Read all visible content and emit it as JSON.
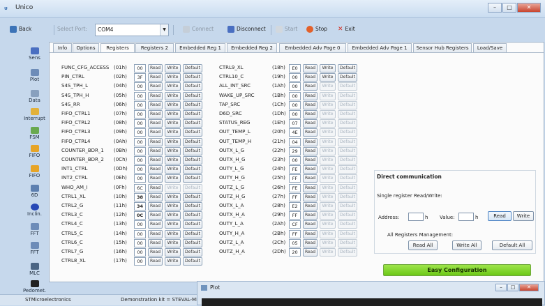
{
  "window": {
    "title": "Unico",
    "app_icon": "unico-logo-icon"
  },
  "toolbar": {
    "back": "Back",
    "select_port": "Select Port:",
    "port": "COM4",
    "connect": "Connect",
    "disconnect": "Disconnect",
    "start": "Start",
    "stop": "Stop",
    "exit": "Exit"
  },
  "sidebar": [
    {
      "label": "Sens",
      "icon": "bars-icon"
    },
    {
      "label": "Plot",
      "icon": "plot-icon"
    },
    {
      "label": "Data",
      "icon": "data-icon"
    },
    {
      "label": "Interrupt",
      "icon": "interrupt-icon"
    },
    {
      "label": "FSM",
      "icon": "fsm-icon"
    },
    {
      "label": "FIFO",
      "icon": "fifo-icon"
    },
    {
      "label": "FIFO",
      "icon": "fifo2-icon"
    },
    {
      "label": "6D",
      "icon": "6d-icon"
    },
    {
      "label": "Inclin.",
      "icon": "inclin-icon"
    },
    {
      "label": "FFT",
      "icon": "fft-icon"
    },
    {
      "label": "FFT",
      "icon": "fft2-icon"
    },
    {
      "label": "MLC",
      "icon": "mlc-icon"
    },
    {
      "label": "Pedomet.",
      "icon": "pedometer-icon"
    }
  ],
  "tabs": [
    "Info",
    "Options",
    "Registers",
    "Registers 2",
    "Embedded Reg 1",
    "Embedded Reg 2",
    "Embedded Adv Page 0",
    "Embedded Adv Page 1",
    "Sensor Hub Registers",
    "Load/Save"
  ],
  "buttons": {
    "read": "Read",
    "write": "Write",
    "default": "Default"
  },
  "registers_left": [
    {
      "name": "FUNC_CFG_ACCESS",
      "addr": "(01h)",
      "value": "00"
    },
    {
      "name": "PIN_CTRL",
      "addr": "(02h)",
      "value": "3F"
    },
    {
      "name": "S4S_TPH_L",
      "addr": "(04h)",
      "value": "00"
    },
    {
      "name": "S4S_TPH_H",
      "addr": "(05h)",
      "value": "00"
    },
    {
      "name": "S4S_RR",
      "addr": "(06h)",
      "value": "00"
    },
    {
      "name": "FIFO_CTRL1",
      "addr": "(07h)",
      "value": "00"
    },
    {
      "name": "FIFO_CTRL2",
      "addr": "(08h)",
      "value": "00"
    },
    {
      "name": "FIFO_CTRL3",
      "addr": "(09h)",
      "value": "00"
    },
    {
      "name": "FIFO_CTRL4",
      "addr": "(0Ah)",
      "value": "00"
    },
    {
      "name": "COUNTER_BDR_1",
      "addr": "(0Bh)",
      "value": "00"
    },
    {
      "name": "COUNTER_BDR_2",
      "addr": "(0Ch)",
      "value": "00"
    },
    {
      "name": "INT1_CTRL",
      "addr": "(0Dh)",
      "value": "00"
    },
    {
      "name": "INT2_CTRL",
      "addr": "(0Eh)",
      "value": "00"
    },
    {
      "name": "WHO_AM_I",
      "addr": "(0Fh)",
      "value": "6C"
    },
    {
      "name": "CTRL1_XL",
      "addr": "(10h)",
      "value": "38"
    },
    {
      "name": "CTRL2_G",
      "addr": "(11h)",
      "value": "34"
    },
    {
      "name": "CTRL3_C",
      "addr": "(12h)",
      "value": "0C"
    },
    {
      "name": "CTRL4_C",
      "addr": "(13h)",
      "value": "00"
    },
    {
      "name": "CTRL5_C",
      "addr": "(14h)",
      "value": "00"
    },
    {
      "name": "CTRL6_C",
      "addr": "(15h)",
      "value": "00"
    },
    {
      "name": "CTRL7_G",
      "addr": "(16h)",
      "value": "00"
    },
    {
      "name": "CTRL8_XL",
      "addr": "(17h)",
      "value": "00"
    }
  ],
  "registers_right": [
    {
      "name": "CTRL9_XL",
      "addr": "(18h)",
      "value": "E0"
    },
    {
      "name": "CTRL10_C",
      "addr": "(19h)",
      "value": "00"
    },
    {
      "name": "ALL_INT_SRC",
      "addr": "(1Ah)",
      "value": "00"
    },
    {
      "name": "WAKE_UP_SRC",
      "addr": "(1Bh)",
      "value": "00"
    },
    {
      "name": "TAP_SRC",
      "addr": "(1Ch)",
      "value": "00"
    },
    {
      "name": "D6D_SRC",
      "addr": "(1Dh)",
      "value": "00"
    },
    {
      "name": "STATUS_REG",
      "addr": "(1Eh)",
      "value": "07"
    },
    {
      "name": "OUT_TEMP_L",
      "addr": "(20h)",
      "value": "4E"
    },
    {
      "name": "OUT_TEMP_H",
      "addr": "(21h)",
      "value": "04"
    },
    {
      "name": "OUTX_L_G",
      "addr": "(22h)",
      "value": "29"
    },
    {
      "name": "OUTX_H_G",
      "addr": "(23h)",
      "value": "00"
    },
    {
      "name": "OUTY_L_G",
      "addr": "(24h)",
      "value": "FE"
    },
    {
      "name": "OUTY_H_G",
      "addr": "(25h)",
      "value": "FF"
    },
    {
      "name": "OUTZ_L_G",
      "addr": "(26h)",
      "value": "FE"
    },
    {
      "name": "OUTZ_H_G",
      "addr": "(27h)",
      "value": "FF"
    },
    {
      "name": "OUTX_L_A",
      "addr": "(28h)",
      "value": "E2"
    },
    {
      "name": "OUTX_H_A",
      "addr": "(29h)",
      "value": "FF"
    },
    {
      "name": "OUTY_L_A",
      "addr": "(2Ah)",
      "value": "CF"
    },
    {
      "name": "OUTY_H_A",
      "addr": "(2Bh)",
      "value": "FF"
    },
    {
      "name": "OUTZ_L_A",
      "addr": "(2Ch)",
      "value": "05"
    },
    {
      "name": "OUTZ_H_A",
      "addr": "(2Dh)",
      "value": "20"
    }
  ],
  "direct": {
    "title": "Direct communication",
    "single": "Single register Read/Write:",
    "address": "Address:",
    "h": "h",
    "value": "Value:",
    "read": "Read",
    "write": "Write",
    "all_mgmt": "All Registers Management:",
    "read_all": "Read All",
    "write_all": "Write All",
    "default_all": "Default All"
  },
  "easy_config": "Easy Configuration",
  "status": {
    "company": "STMicroelectronics",
    "demo": "Demonstration kit = STEVAL-MKI"
  },
  "plot_window": {
    "title": "Plot"
  }
}
